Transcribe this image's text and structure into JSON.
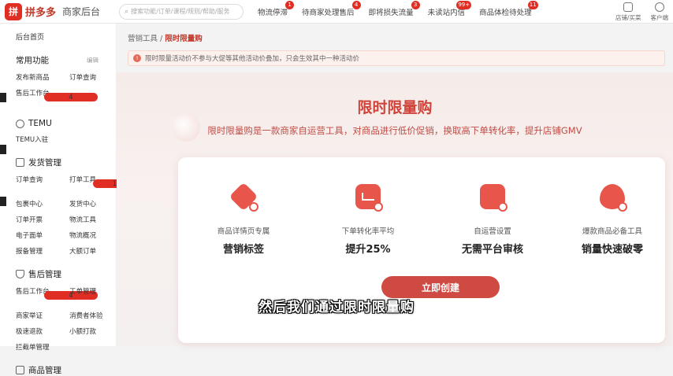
{
  "topbar": {
    "logo_badge": "拼",
    "logo_text": "拼多多",
    "logo_sub": "商家后台",
    "search_placeholder": "搜索功能/订单/课程/规则/帮助/服务",
    "nav": [
      {
        "label": "物流停滞",
        "badge": "1"
      },
      {
        "label": "待商家处理售后",
        "badge": "4"
      },
      {
        "label": "即将损失流量",
        "badge": "3"
      },
      {
        "label": "未读站内信",
        "badge": "99+"
      },
      {
        "label": "商品体检待处理",
        "badge": "11"
      }
    ],
    "right": [
      {
        "label": "店铺/买菜",
        "icon": "shop-icon"
      },
      {
        "label": "客户端",
        "icon": "desktop-icon"
      }
    ]
  },
  "sidebar": {
    "home": "后台首页",
    "common_title": "常用功能",
    "common_extra": "编辑",
    "common_items": [
      {
        "label": "发布新商品",
        "badge": ""
      },
      {
        "label": "订单查询",
        "badge": ""
      },
      {
        "label": "售后工作台",
        "badge": "4"
      }
    ],
    "sections": [
      {
        "title": "TEMU",
        "icon": "temu-icon",
        "items": [
          {
            "label": "TEMU入驻",
            "badge": ""
          }
        ]
      },
      {
        "title": "发货管理",
        "icon": "shipping-icon",
        "items": [
          {
            "label": "订单查询",
            "badge": ""
          },
          {
            "label": "打单工具",
            "badge": "10"
          },
          {
            "label": "包裹中心",
            "badge": ""
          },
          {
            "label": "发货中心",
            "badge": ""
          },
          {
            "label": "订单开票",
            "badge": ""
          },
          {
            "label": "物流工具",
            "badge": ""
          },
          {
            "label": "电子面单",
            "badge": ""
          },
          {
            "label": "物流概况",
            "badge": ""
          },
          {
            "label": "报备管理",
            "badge": ""
          },
          {
            "label": "大额订单",
            "badge": ""
          }
        ]
      },
      {
        "title": "售后管理",
        "icon": "shield-icon",
        "items": [
          {
            "label": "售后工作台",
            "badge": "4"
          },
          {
            "label": "工单管理",
            "badge": ""
          },
          {
            "label": "商家举证",
            "badge": ""
          },
          {
            "label": "消费者体验",
            "badge": ""
          },
          {
            "label": "极速退款",
            "badge": ""
          },
          {
            "label": "小额打款",
            "badge": ""
          },
          {
            "label": "拦截单管理",
            "badge": ""
          }
        ]
      },
      {
        "title": "商品管理",
        "icon": "goods-icon",
        "items": []
      }
    ]
  },
  "breadcrumb": {
    "parent": "营销工具",
    "sep": "/",
    "current": "限时限量购"
  },
  "notice": {
    "text": "限时限量活动价不参与大促等其他活动价叠加，只会生效其中一种活动价"
  },
  "hero": {
    "title": "限时限量购",
    "subtitle": "限时限量购是一款商家自运营工具，对商品进行低价促销，换取高下单转化率，提升店铺GMV",
    "features": [
      {
        "desc": "商品详情页专属",
        "big": "营销标签",
        "icon": "tag-icon"
      },
      {
        "desc": "下单转化率平均",
        "big": "提升25%",
        "icon": "chart-icon"
      },
      {
        "desc": "自运营设置",
        "big": "无需平台审核",
        "icon": "clipboard-icon"
      },
      {
        "desc": "爆款商品必备工具",
        "big": "销量快速破零",
        "icon": "fire-icon"
      }
    ],
    "create_button": "立即创建"
  },
  "caption": "然后我们通过限时限量购",
  "colors": {
    "brand": "#e02e24",
    "accent": "#cf4a43",
    "title": "#d0433a"
  }
}
